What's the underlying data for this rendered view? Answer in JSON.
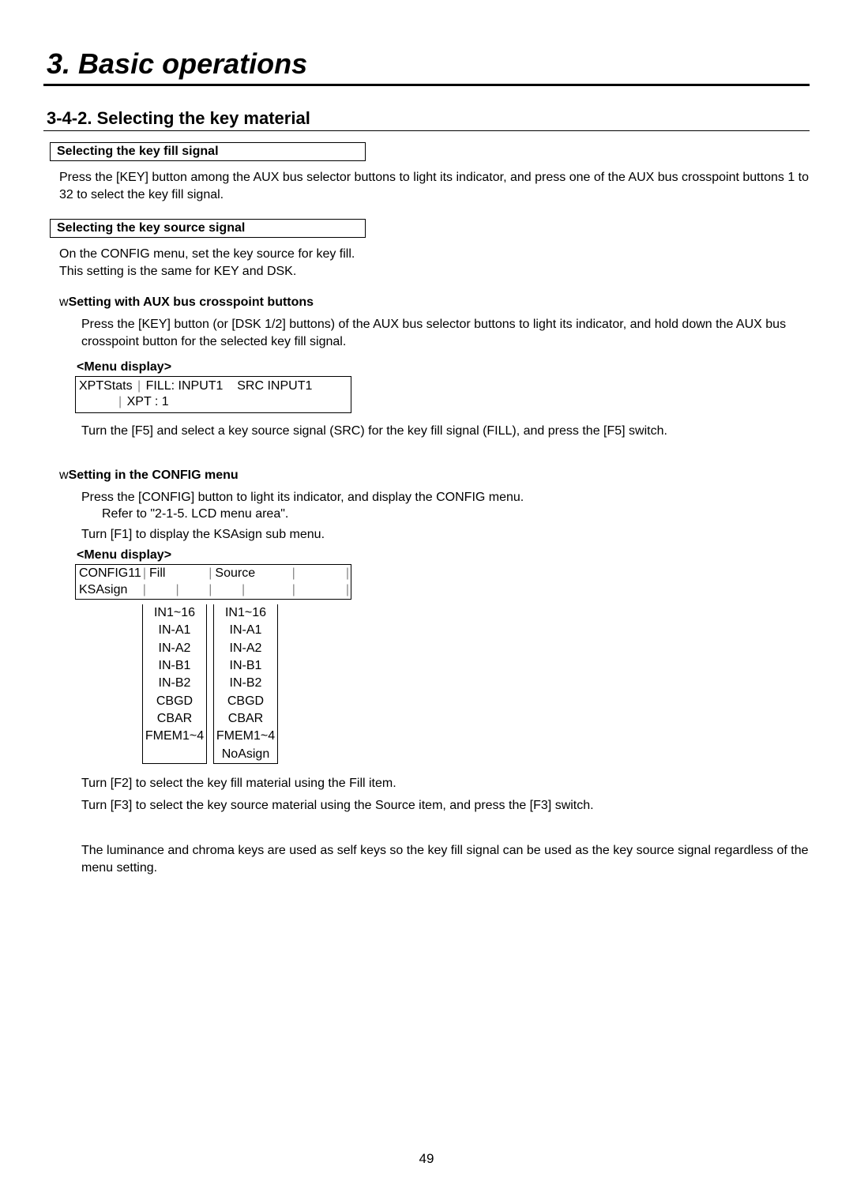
{
  "chapter": "3. Basic operations",
  "section": "3-4-2. Selecting the key material",
  "box1": {
    "title": "Selecting the key fill signal",
    "text": "Press the [KEY] button among the AUX bus selector buttons to light its indicator, and press one of the AUX bus crosspoint buttons 1 to 32 to select the key fill signal."
  },
  "box2": {
    "title": "Selecting the key source signal",
    "text1": "On the CONFIG menu, set the key source for key fill.",
    "text2": "This setting is the same for KEY and DSK."
  },
  "setting1": {
    "prefix": "w",
    "title": "Setting with AUX bus crosspoint buttons",
    "text": "Press the [KEY] button (or [DSK 1/2] buttons) of the AUX bus selector buttons to light its indicator, and hold down the AUX bus crosspoint button for the selected key fill signal.",
    "menuLabel": "<Menu display>",
    "menu": {
      "line1_a": "XPTStats",
      "line1_b": "FILL: INPUT1",
      "line1_c": "SRC  INPUT1",
      "line2": "XPT : 1"
    },
    "afterText": "Turn the [F5] and select a key source signal (SRC) for the key fill signal (FILL), and press the [F5] switch."
  },
  "setting2": {
    "prefix": "w",
    "title": "Setting in the CONFIG menu",
    "text1": "Press the [CONFIG] button to light its indicator, and display the CONFIG menu.",
    "text1b": "Refer to \"2-1-5. LCD menu area\".",
    "text2": "Turn [F1] to display the KSAsign sub menu.",
    "menuLabel": "<Menu display>",
    "menu": {
      "r1c1": "CONFIG11",
      "r1c2": "Fill",
      "r1c3": "Source",
      "r2c1": "KSAsign"
    },
    "fillOptions": [
      "IN1~16",
      "IN-A1",
      "IN-A2",
      "IN-B1",
      "IN-B2",
      "CBGD",
      "CBAR",
      "FMEM1~4"
    ],
    "sourceOptions": [
      "IN1~16",
      "IN-A1",
      "IN-A2",
      "IN-B1",
      "IN-B2",
      "CBGD",
      "CBAR",
      "FMEM1~4",
      "NoAsign"
    ],
    "afterText1": "Turn [F2] to select the key fill material using the Fill item.",
    "afterText2": "Turn [F3] to select the key source material using the Source item, and press the [F3] switch.",
    "footerText": "The luminance and chroma keys are used as self keys so the key fill signal can be used as the key source signal regardless of the menu setting."
  },
  "pageNumber": "49"
}
